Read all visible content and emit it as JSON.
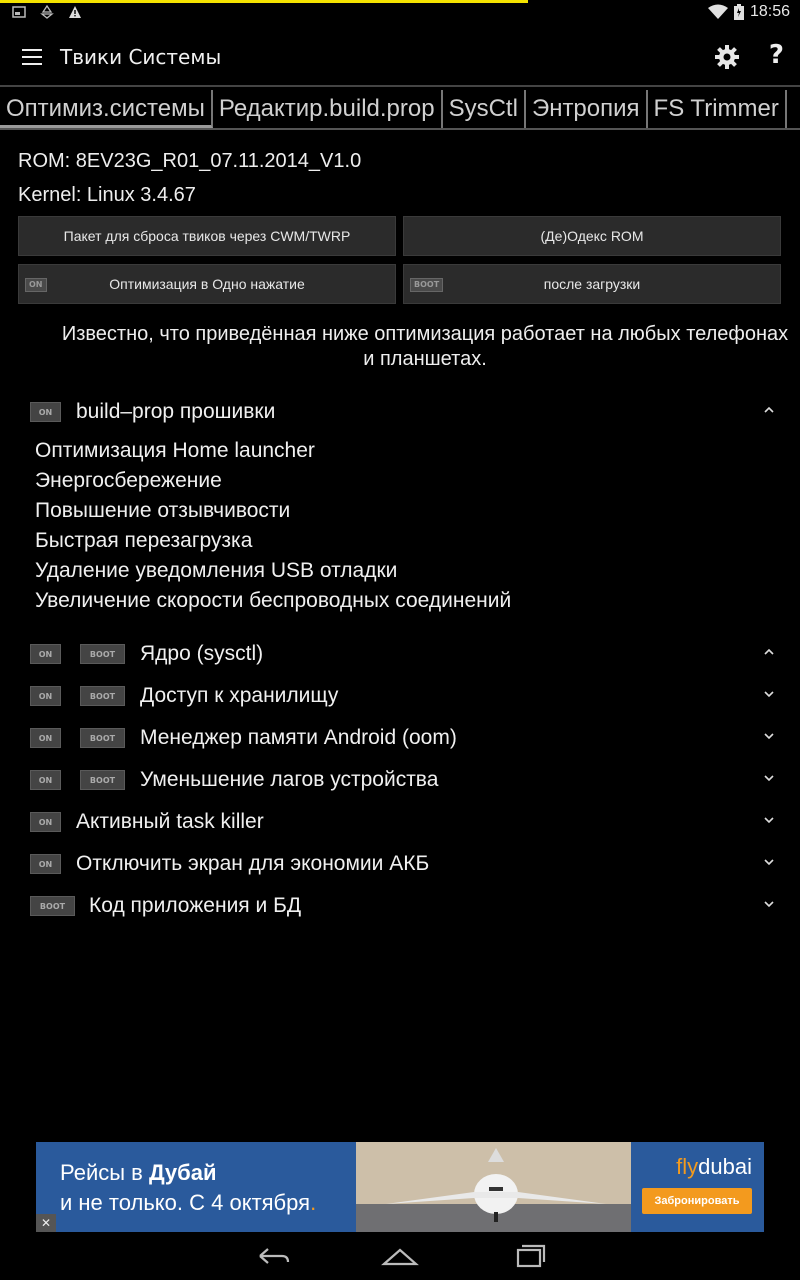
{
  "status": {
    "time": "18:56",
    "left_icons": [
      "image-notification-icon",
      "recycle-notification-icon",
      "warning-icon"
    ],
    "progress_fraction": 0.66,
    "progress_color": "#f4e300"
  },
  "appbar": {
    "title": "Твики Системы",
    "help_label": "?"
  },
  "tabs": [
    "Оптимиз.системы",
    "Редактир.build.prop",
    "SysCtl",
    "Энтропия",
    "FS Trimmer"
  ],
  "info": {
    "rom": "ROM: 8EV23G_R01_07.11.2014_V1.0",
    "kernel": "Kernel: Linux 3.4.67"
  },
  "buttons": {
    "reset_pack": "Пакет для сброса твиков через CWM/TWRP",
    "deodex": "(Де)Одекс ROM",
    "one_click": "Оптимизация в Одно нажатие",
    "after_boot": "после загрузки"
  },
  "tags": {
    "on": "ON",
    "boot": "BOOT"
  },
  "notice": "Известно, что приведённая ниже оптимизация работает на любых телефонах и планшетах.",
  "sections": {
    "build_prop": {
      "label": "build–prop прошивки",
      "items": [
        "Оптимизация Home launcher",
        "Энергосбережение",
        "Повышение отзывчивости",
        "Быстрая перезагрузка",
        "Удаление уведомления USB отладки",
        "Увеличение скорости беспроводных соединений"
      ]
    },
    "kernel": {
      "label": "Ядро (sysctl)"
    },
    "storage": {
      "label": "Доступ к хранилищу"
    },
    "oom": {
      "label": "Менеджер памяти Android (oom)"
    },
    "lags": {
      "label": "Уменьшение лагов устройства"
    },
    "taskkiller": {
      "label": "Активный task killer"
    },
    "screen_off": {
      "label": "Отключить экран для экономии АКБ"
    },
    "app_code": {
      "label": "Код приложения и БД"
    }
  },
  "ad": {
    "line1_prefix": "Рейсы в ",
    "line1_bold": "Дубай",
    "line2": "и не только. С 4 октября",
    "line2_dot": ".",
    "brand_fly": "fly",
    "brand_dubai": "dubai",
    "cta": "Забронировать",
    "close": "✕"
  }
}
